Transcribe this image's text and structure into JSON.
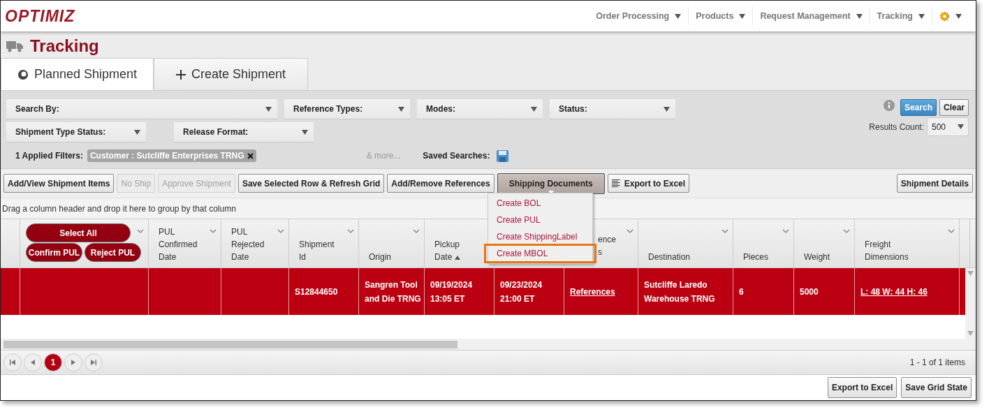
{
  "brand": {
    "logo": "OPTIMIZ"
  },
  "nav": [
    {
      "label": "Order Processing",
      "kind": "text"
    },
    {
      "label": "Products",
      "kind": "text"
    },
    {
      "label": "Request Management",
      "kind": "text"
    },
    {
      "label": "Tracking",
      "kind": "text"
    },
    {
      "kind": "settings"
    }
  ],
  "page_title": "Tracking",
  "tabs": [
    {
      "label": "Planned Shipment",
      "selected": true,
      "kind": "planned"
    },
    {
      "label": "Create Shipment",
      "selected": false,
      "kind": "create"
    }
  ],
  "filters": {
    "row1": [
      {
        "label": "Search By:"
      },
      {
        "label": "Reference Types:"
      },
      {
        "label": "Modes:"
      },
      {
        "label": "Status:"
      }
    ],
    "row2": [
      {
        "label": "Shipment Type Status:"
      },
      {
        "label": "Release Format:"
      }
    ],
    "applied_label": "1 Applied Filters:",
    "applied": [
      {
        "text": "Customer : Sutcliffe Enterprises TRNG"
      }
    ],
    "more": "& more...",
    "saved_searches": "Saved Searches:",
    "search_button": "Search",
    "clear_button": "Clear",
    "results_count_label": "Results Count:",
    "results_count": "500"
  },
  "toolbar": [
    {
      "label": "Add/View Shipment Items",
      "disabled": false,
      "kind": "button"
    },
    {
      "label": "No Ship",
      "disabled": true,
      "kind": "button"
    },
    {
      "label": "Approve Shipment",
      "disabled": true,
      "kind": "button"
    },
    {
      "label": "Save Selected Row & Refresh Grid",
      "disabled": false,
      "kind": "button"
    },
    {
      "label": "Add/Remove References",
      "disabled": false,
      "kind": "button"
    },
    {
      "label": "Shipping Documents",
      "kind": "menu"
    },
    {
      "label": "Export to Excel",
      "kind": "export"
    }
  ],
  "toolbar_right": "Shipment Details",
  "menu": {
    "items": [
      {
        "label": "Create BOL",
        "highlighted": false
      },
      {
        "label": "Create PUL",
        "highlighted": false
      },
      {
        "label": "Create ShippingLabel",
        "highlighted": false
      },
      {
        "label": "Create MBOL",
        "highlighted": true
      }
    ]
  },
  "group_hint": "Drag a column header and drop it here to group by that column",
  "grid": {
    "header_buttons": {
      "select_all": "Select All",
      "confirm": "Confirm PUL",
      "reject": "Reject PUL"
    },
    "columns": [
      {
        "kind": "check"
      },
      {
        "kind": "actions",
        "filter": true
      },
      {
        "kind": "text",
        "lines": [
          "PUL",
          "Confirmed",
          "Date"
        ],
        "filter": true
      },
      {
        "kind": "text",
        "lines": [
          "PUL",
          "Rejected",
          "Date"
        ],
        "filter": true
      },
      {
        "kind": "text",
        "lines": [
          "Shipment",
          "Id"
        ],
        "filter": true
      },
      {
        "kind": "text",
        "lines": [
          "Origin"
        ],
        "filter": true
      },
      {
        "kind": "text",
        "lines": [
          "Pickup",
          "Date"
        ],
        "filter": false,
        "sorted_ascending": true
      },
      {
        "kind": "covered"
      },
      {
        "kind": "partial",
        "lines": [
          "ence",
          "s"
        ],
        "filter": true
      },
      {
        "kind": "text",
        "lines": [
          "Destination"
        ],
        "filter": true
      },
      {
        "kind": "text",
        "lines": [
          "Pieces"
        ],
        "filter": true
      },
      {
        "kind": "text",
        "lines": [
          "Weight"
        ],
        "filter": true
      },
      {
        "kind": "text",
        "lines": [
          "Freight",
          "Dimensions"
        ],
        "filter": true
      },
      {
        "kind": "spacer"
      }
    ],
    "rows": [
      {
        "selected": true,
        "cells": [
          {
            "kind": "empty"
          },
          {
            "kind": "empty"
          },
          {
            "kind": "empty"
          },
          {
            "kind": "empty"
          },
          {
            "kind": "text",
            "lines": [
              "S12844650"
            ]
          },
          {
            "kind": "text",
            "lines": [
              "Sangren Tool",
              "and Die TRNG"
            ]
          },
          {
            "kind": "text",
            "lines": [
              "09/19/2024",
              "13:05 ET"
            ]
          },
          {
            "kind": "text",
            "lines": [
              "09/23/2024",
              "21:00 ET"
            ]
          },
          {
            "kind": "link",
            "lines": [
              "References"
            ]
          },
          {
            "kind": "text",
            "lines": [
              "Sutcliffe Laredo",
              "Warehouse TRNG"
            ]
          },
          {
            "kind": "text",
            "lines": [
              "6"
            ]
          },
          {
            "kind": "text",
            "lines": [
              "5000"
            ]
          },
          {
            "kind": "link",
            "lines": [
              "L: 48 W: 44 H: 46"
            ]
          },
          {
            "kind": "empty"
          }
        ]
      }
    ]
  },
  "pager": {
    "pages": [
      {
        "label": "1",
        "selected": true
      }
    ],
    "summary": "1 - 1 of 1 items"
  },
  "footer_buttons": [
    "Export to Excel",
    "Save Grid State"
  ]
}
